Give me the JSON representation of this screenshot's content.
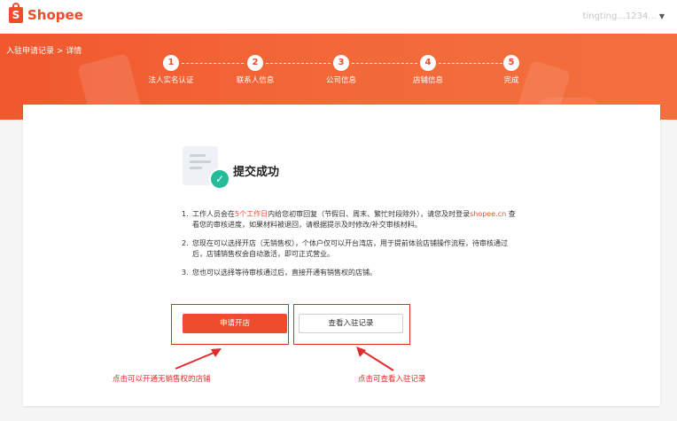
{
  "header": {
    "logo_text": "Shopee",
    "logo_glyph": "S",
    "account_name": "tingting...1234...",
    "account_chevron": "chevron-down-icon"
  },
  "breadcrumb": {
    "text": "入驻申请记录 > 详情"
  },
  "steps": [
    {
      "num": "1",
      "label": "法人实名认证"
    },
    {
      "num": "2",
      "label": "联系人信息"
    },
    {
      "num": "3",
      "label": "公司信息"
    },
    {
      "num": "4",
      "label": "店铺信息"
    },
    {
      "num": "5",
      "label": "完成"
    }
  ],
  "result": {
    "title": "提交成功",
    "notes": [
      {
        "num": "1.",
        "part1": "工作人员会在",
        "highlight": "5个工作日",
        "part2": "内给您初审回复（节假日、周末、繁忙时段除外），请您及时登录",
        "link": "shopee.cn",
        "part3": " 查看您的审核进度，如果材料被退回，请根据提示及时修改/补交审核材料。"
      },
      {
        "num": "2.",
        "text": "您现在可以选择开店（无销售权），个体户仅可以开台湾店，用于提前体验店铺操作流程，待审核通过后，店铺销售权会自动激活，即可正式营业。"
      },
      {
        "num": "3.",
        "text": "您也可以选择等待审核通过后，直接开通有销售权的店铺。"
      }
    ]
  },
  "buttons": {
    "apply_label": "申请开店",
    "record_label": "查看入驻记录"
  },
  "annotations": {
    "left": "点击可以开通无销售权的店铺",
    "right": "点击可查看入驻记录"
  },
  "colors": {
    "brand": "#ee4d2d",
    "success": "#24bc99",
    "annotation": "#e12b2b"
  }
}
